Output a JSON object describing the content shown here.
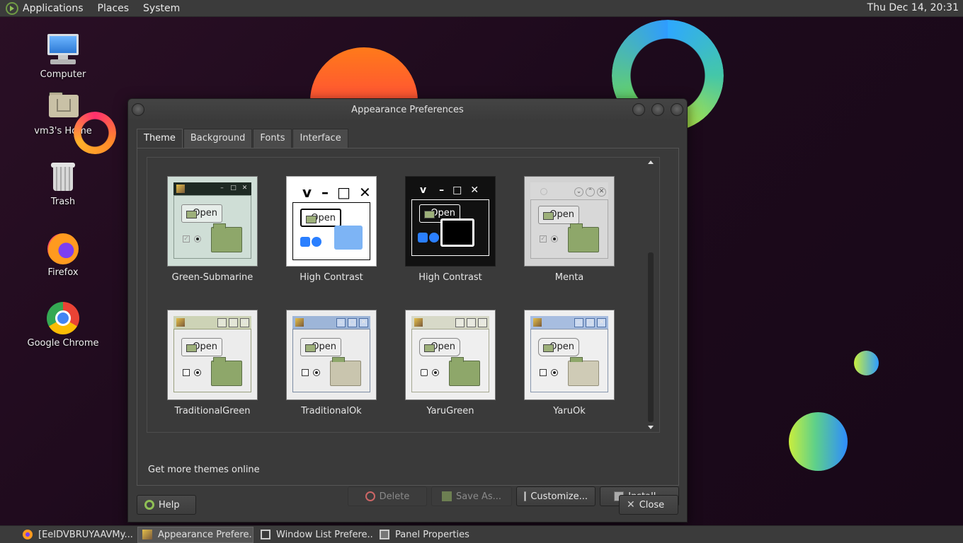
{
  "top_panel": {
    "menus": [
      "Applications",
      "Places",
      "System"
    ],
    "clock": "Thu Dec 14, 20:31"
  },
  "desktop_icons": [
    {
      "label": "Computer",
      "icon": "computer-icon"
    },
    {
      "label": "vm3's Home",
      "icon": "home-folder-icon"
    },
    {
      "label": "Trash",
      "icon": "trash-icon"
    },
    {
      "label": "Firefox",
      "icon": "firefox-icon"
    },
    {
      "label": "Google Chrome",
      "icon": "chrome-icon"
    }
  ],
  "window": {
    "title": "Appearance Preferences",
    "tabs": [
      "Theme",
      "Background",
      "Fonts",
      "Interface"
    ],
    "active_tab": "Theme",
    "themes": [
      {
        "name": "Green-Submarine",
        "style": "green",
        "open_label": "Open"
      },
      {
        "name": "High Contrast",
        "style": "hc-light",
        "open_label": "Open"
      },
      {
        "name": "High Contrast",
        "style": "hc-dark",
        "open_label": "Open"
      },
      {
        "name": "Menta",
        "style": "menta",
        "open_label": "Open"
      },
      {
        "name": "TraditionalGreen",
        "style": "trad-green",
        "open_label": "Open"
      },
      {
        "name": "TraditionalOk",
        "style": "trad-ok",
        "open_label": "Open"
      },
      {
        "name": "YaruGreen",
        "style": "yaru-green",
        "open_label": "Open"
      },
      {
        "name": "YaruOk",
        "style": "yaru-ok",
        "open_label": "Open"
      }
    ],
    "buttons": {
      "delete": "Delete",
      "save_as": "Save As...",
      "customize": "Customize...",
      "install": "Install...",
      "help": "Help",
      "close": "Close"
    },
    "more_themes_link": "Get more themes online"
  },
  "taskbar": {
    "tasks": [
      {
        "label": "[EeIDVBRUYAAVMy...",
        "icon": "firefox-icon",
        "active": false
      },
      {
        "label": "Appearance Prefere...",
        "icon": "appearance-icon",
        "active": true
      },
      {
        "label": "Window List Prefere...",
        "icon": "window-list-icon",
        "active": false
      },
      {
        "label": "Panel Properties",
        "icon": "panel-icon",
        "active": false
      }
    ]
  },
  "colors": {
    "desktop_bg": "#1d0a1c",
    "panel_bg": "#3b3b3b",
    "window_bg": "#3a3a3a"
  }
}
